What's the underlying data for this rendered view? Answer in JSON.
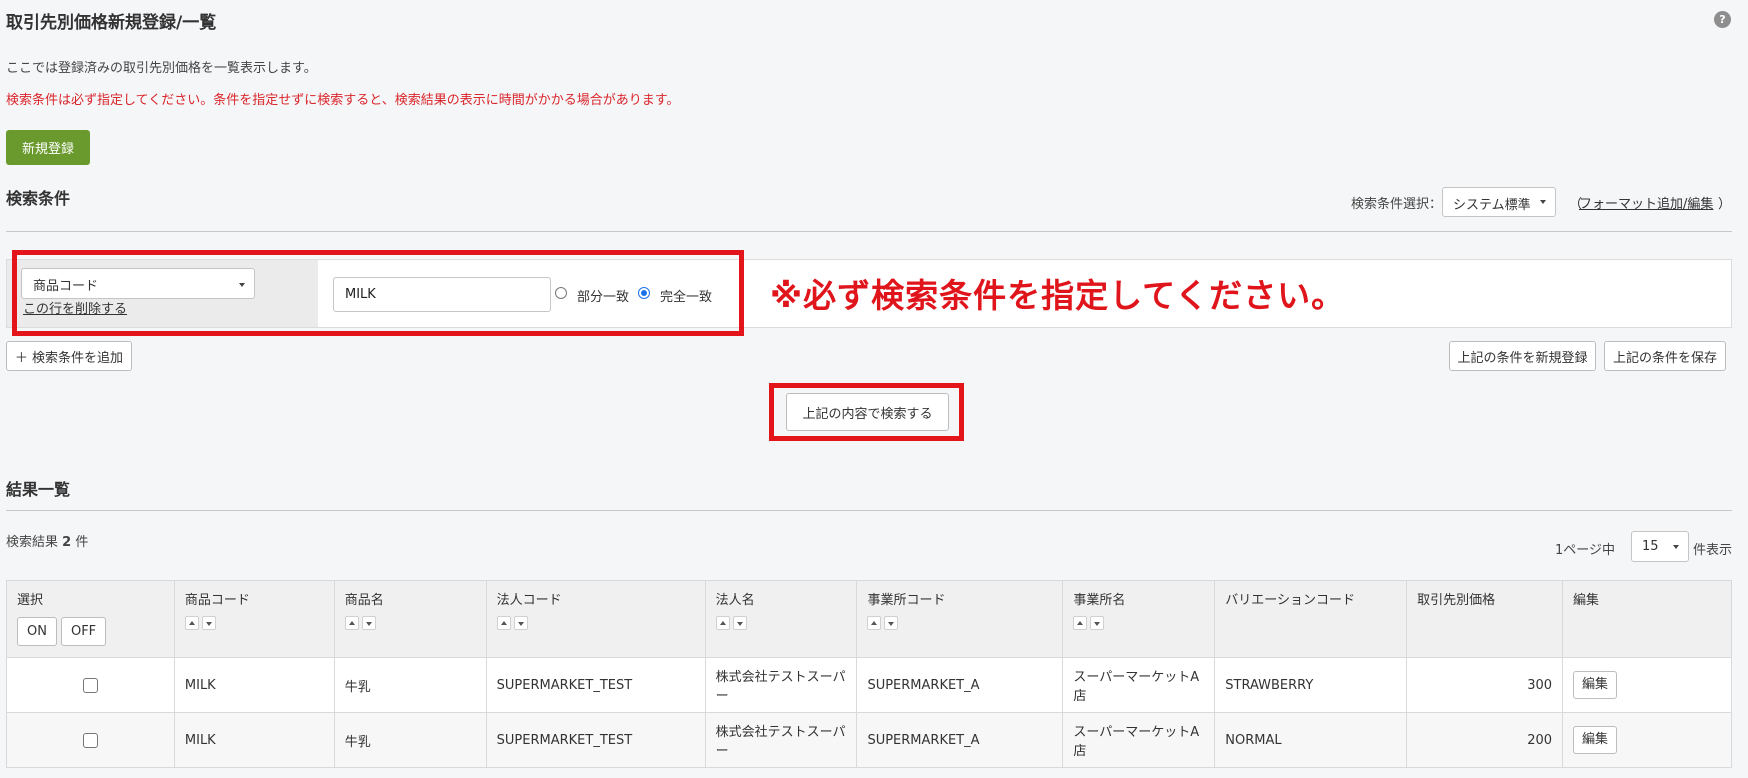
{
  "page": {
    "title": "取引先別価格新規登録/一覧",
    "help_icon": "?",
    "description": "ここでは登録済みの取引先別価格を一覧表示します。",
    "warning": "検索条件は必ず指定してください。条件を指定せずに検索すると、検索結果の表示に時間がかかる場合があります。",
    "new_button": "新規登録"
  },
  "search": {
    "section_title": "検索条件",
    "format_label": "検索条件選択：",
    "format_value": "システム標準",
    "format_paren_open": "（",
    "format_link": "フォーマット追加/編集",
    "format_paren_close": "）",
    "field_value": "商品コード",
    "delete_row": "この行を削除する",
    "input_value": "MILK",
    "match_partial": "部分一致",
    "match_exact": "完全一致",
    "match_selected": "完全一致",
    "notice": "※必ず検索条件を指定してください。",
    "add_condition": "＋ 検索条件を追加",
    "save_as_new": "上記の条件を新規登録",
    "save_condition": "上記の条件を保存",
    "search_button": "上記の内容で検索する"
  },
  "results": {
    "section_title": "結果一覧",
    "count_prefix": "検索結果 ",
    "count": "2",
    "count_suffix": " 件",
    "per_page_prefix": "1ページ中",
    "per_page_value": "15",
    "per_page_suffix": "件表示",
    "columns": {
      "select": "選択",
      "on": "ON",
      "off": "OFF",
      "product_code": "商品コード",
      "product_name": "商品名",
      "corp_code": "法人コード",
      "corp_name": "法人名",
      "office_code": "事業所コード",
      "office_name": "事業所名",
      "variation_code": "バリエーションコード",
      "price": "取引先別価格",
      "edit": "編集"
    },
    "rows": [
      {
        "product_code": "MILK",
        "product_name": "牛乳",
        "corp_code": "SUPERMARKET_TEST",
        "corp_name": "株式会社テストスーパー",
        "office_code": "SUPERMARKET_A",
        "office_name": "スーパーマーケットA店",
        "variation_code": "STRAWBERRY",
        "price": "300",
        "edit": "編集"
      },
      {
        "product_code": "MILK",
        "product_name": "牛乳",
        "corp_code": "SUPERMARKET_TEST",
        "corp_name": "株式会社テストスーパー",
        "office_code": "SUPERMARKET_A",
        "office_name": "スーパーマーケットA店",
        "variation_code": "NORMAL",
        "price": "200",
        "edit": "編集"
      }
    ]
  },
  "colors": {
    "accent_green": "#6a9a2e",
    "warning_red": "#d9262b",
    "highlight_red": "#e3151a"
  }
}
